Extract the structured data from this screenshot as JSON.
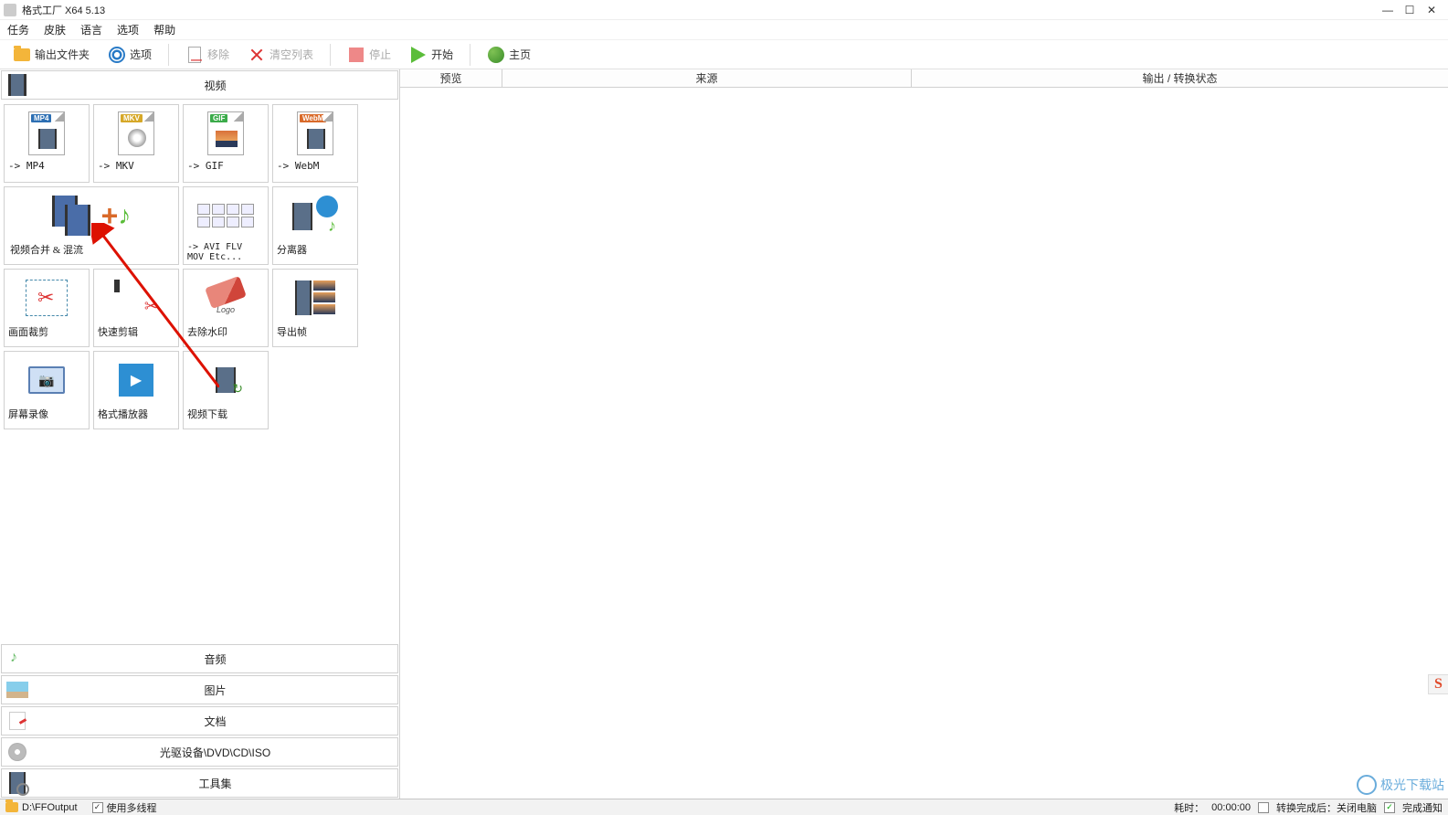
{
  "title": "格式工厂 X64 5.13",
  "menu": {
    "task": "任务",
    "skin": "皮肤",
    "lang": "语言",
    "option": "选项",
    "help": "帮助"
  },
  "toolbar": {
    "output_folder": "输出文件夹",
    "options": "选项",
    "remove": "移除",
    "clear": "清空列表",
    "stop": "停止",
    "start": "开始",
    "home": "主页"
  },
  "categories": {
    "video": "视频",
    "audio": "音频",
    "image": "图片",
    "document": "文档",
    "disc": "光驱设备\\DVD\\CD\\ISO",
    "toolset": "工具集"
  },
  "tiles": {
    "mp4": "-> MP4",
    "mkv": "-> MKV",
    "gif": "-> GIF",
    "webm": "-> WebM",
    "merge": "视频合并 & 混流",
    "avi": "-> AVI FLV MOV Etc...",
    "separator": "分离器",
    "crop": "画面裁剪",
    "quickcut": "快速剪辑",
    "watermark_rm": "去除水印",
    "export_frame": "导出帧",
    "screen_rec": "屏幕录像",
    "player": "格式播放器",
    "download": "视频下载"
  },
  "list_headers": {
    "preview": "预览",
    "source": "来源",
    "status": "输出 / 转换状态"
  },
  "statusbar": {
    "output_path": "D:\\FFOutput",
    "multithread": "使用多线程",
    "elapsed_label": "耗时：",
    "elapsed_time": "00:00:00",
    "shutdown": "转换完成后：关闭电脑",
    "notify": "完成通知"
  },
  "watermark": "极光下载站"
}
